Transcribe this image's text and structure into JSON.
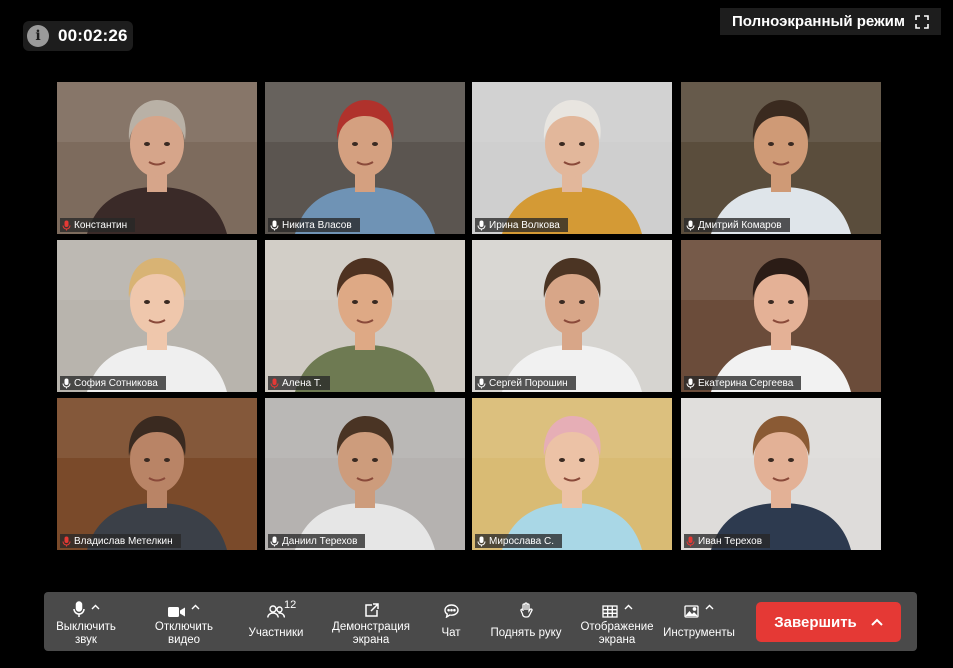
{
  "timer": {
    "time": "00:02:26",
    "icon": "info-icon"
  },
  "fullscreen": {
    "label": "Полноэкранный режим",
    "icon": "fullscreen-icon"
  },
  "participants": [
    {
      "name": "Константин",
      "mic": "muted",
      "bg": "#7d6b5d",
      "skin": "#d6a58a",
      "hair": "#b9b1a6",
      "shirt": "#3a2a28"
    },
    {
      "name": "Никита Власов",
      "mic": "on",
      "bg": "#5b5550",
      "skin": "#d4a080",
      "hair": "#b0322c",
      "shirt": "#6f93b5"
    },
    {
      "name": "Ирина Волкова",
      "mic": "on",
      "bg": "#cfcfcf",
      "skin": "#e2b79b",
      "hair": "#e8e5e0",
      "shirt": "#d49a35"
    },
    {
      "name": "Дмитрий Комаров",
      "mic": "on",
      "bg": "#5a4d3c",
      "skin": "#cf9a76",
      "hair": "#3a2a1f",
      "shirt": "#dfe5ea"
    },
    {
      "name": "София  Сотникова",
      "mic": "on",
      "bg": "#b8b4ad",
      "skin": "#efc7ac",
      "hair": "#d8b374",
      "shirt": "#efefef"
    },
    {
      "name": "Алена Т.",
      "mic": "muted",
      "bg": "#cfcac3",
      "skin": "#dea985",
      "hair": "#4e3221",
      "shirt": "#6e7a52"
    },
    {
      "name": "Сергей Порошин",
      "mic": "on",
      "bg": "#d6d4d0",
      "skin": "#d8a688",
      "hair": "#4b3423",
      "shirt": "#f1f1f1"
    },
    {
      "name": "Екатерина Сергеева",
      "mic": "on",
      "bg": "#6b4c3a",
      "skin": "#e4b196",
      "hair": "#2b1c16",
      "shirt": "#f2f2f2"
    },
    {
      "name": "Владислав Метелкин",
      "mic": "muted",
      "bg": "#7a4a2a",
      "skin": "#b98466",
      "hair": "#3a2a20",
      "shirt": "#3b4048"
    },
    {
      "name": "Даниил Терехов",
      "mic": "on",
      "bg": "#b5b2b0",
      "skin": "#cd9c7c",
      "hair": "#4a3424",
      "shirt": "#e6e6e6"
    },
    {
      "name": "Мирослава С.",
      "mic": "on",
      "bg": "#d9bb74",
      "skin": "#ecc2a6",
      "hair": "#e6aeb6",
      "shirt": "#a9d7e6"
    },
    {
      "name": "Иван Терехов",
      "mic": "muted",
      "bg": "#dedcda",
      "skin": "#e3b196",
      "hair": "#8a5a34",
      "shirt": "#2d3a4f"
    }
  ],
  "toolbar": {
    "mute": {
      "label": "Выключить звук",
      "icon": "microphone-icon"
    },
    "video": {
      "label": "Отключить видео",
      "icon": "video-camera-icon"
    },
    "participants": {
      "label": "Участники",
      "count": "12",
      "icon": "people-icon"
    },
    "share": {
      "label": "Демонстрация экрана",
      "icon": "share-screen-icon"
    },
    "chat": {
      "label": "Чат",
      "icon": "chat-icon"
    },
    "raise_hand": {
      "label": "Поднять руку",
      "icon": "hand-icon"
    },
    "layout": {
      "label": "Отображение экрана",
      "icon": "grid-icon"
    },
    "tools": {
      "label": "Инструменты",
      "icon": "image-icon"
    },
    "end": {
      "label": "Завершить",
      "icon": "chevron-up-icon"
    }
  },
  "colors": {
    "end_button": "#e53935",
    "muted_mic": "#e53935",
    "toolbar": "#4a4a4a"
  }
}
